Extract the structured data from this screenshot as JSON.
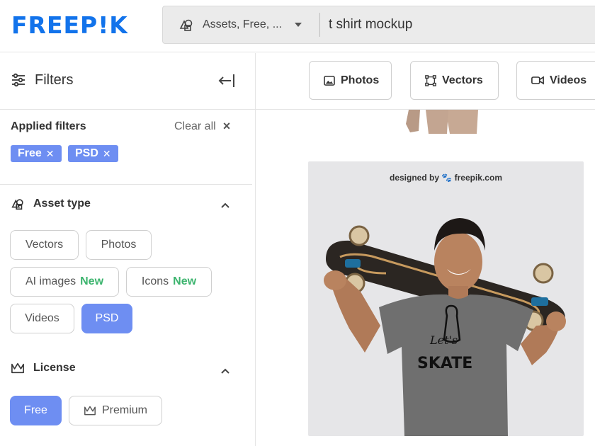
{
  "header": {
    "logo": "FREEP!K",
    "asset_select_value": "Assets, Free, ...",
    "search_value": "t shirt mockup"
  },
  "sidebar": {
    "title": "Filters",
    "applied_label": "Applied filters",
    "clear_all": "Clear all",
    "applied_chips": [
      {
        "label": "Free"
      },
      {
        "label": "PSD"
      }
    ],
    "asset_type": {
      "title": "Asset type",
      "options": [
        {
          "label": "Vectors",
          "active": false
        },
        {
          "label": "Photos",
          "active": false
        },
        {
          "label": "AI images",
          "badge": "New",
          "active": false
        },
        {
          "label": "Icons",
          "badge": "New",
          "active": false
        },
        {
          "label": "Videos",
          "active": false
        },
        {
          "label": "PSD",
          "active": true
        }
      ]
    },
    "license": {
      "title": "License",
      "options": [
        {
          "label": "Free",
          "active": true
        },
        {
          "label": "Premium",
          "active": false
        }
      ]
    }
  },
  "main": {
    "tabs": [
      {
        "label": "Photos",
        "icon": "image-icon"
      },
      {
        "label": "Vectors",
        "icon": "vector-nodes-icon"
      },
      {
        "label": "Videos",
        "icon": "video-camera-icon"
      }
    ],
    "result": {
      "watermark": "designed by 🐾 freepik.com",
      "shirt_text": "Let's SKATE"
    }
  },
  "colors": {
    "brand_blue": "#1273eb",
    "chip_blue": "#6e8ef2",
    "new_green": "#3cb46e"
  }
}
